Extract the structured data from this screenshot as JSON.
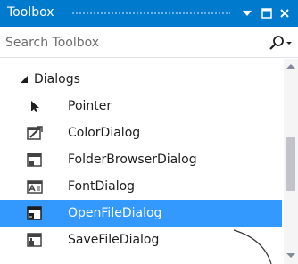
{
  "window": {
    "title": "Toolbox",
    "title_bar_color": "#007acc",
    "buttons": {
      "dropdown_icon": "dropdown-arrow-icon",
      "maximize_icon": "maximize-icon",
      "close_icon": "close-icon"
    }
  },
  "search": {
    "placeholder": "Search Toolbox",
    "icon": "search-icon"
  },
  "toolbox": {
    "group": {
      "label": "Dialogs",
      "expanded": true
    },
    "items": [
      {
        "label": "Pointer",
        "icon": "pointer-icon"
      },
      {
        "label": "ColorDialog",
        "icon": "color-dialog-icon"
      },
      {
        "label": "FolderBrowserDialog",
        "icon": "folder-browser-dialog-icon"
      },
      {
        "label": "FontDialog",
        "icon": "font-dialog-icon"
      },
      {
        "label": "OpenFileDialog",
        "icon": "open-file-dialog-icon",
        "selected": true
      },
      {
        "label": "SaveFileDialog",
        "icon": "save-file-dialog-icon"
      }
    ]
  },
  "colors": {
    "selection": "#3399ff",
    "accent": "#007acc"
  }
}
